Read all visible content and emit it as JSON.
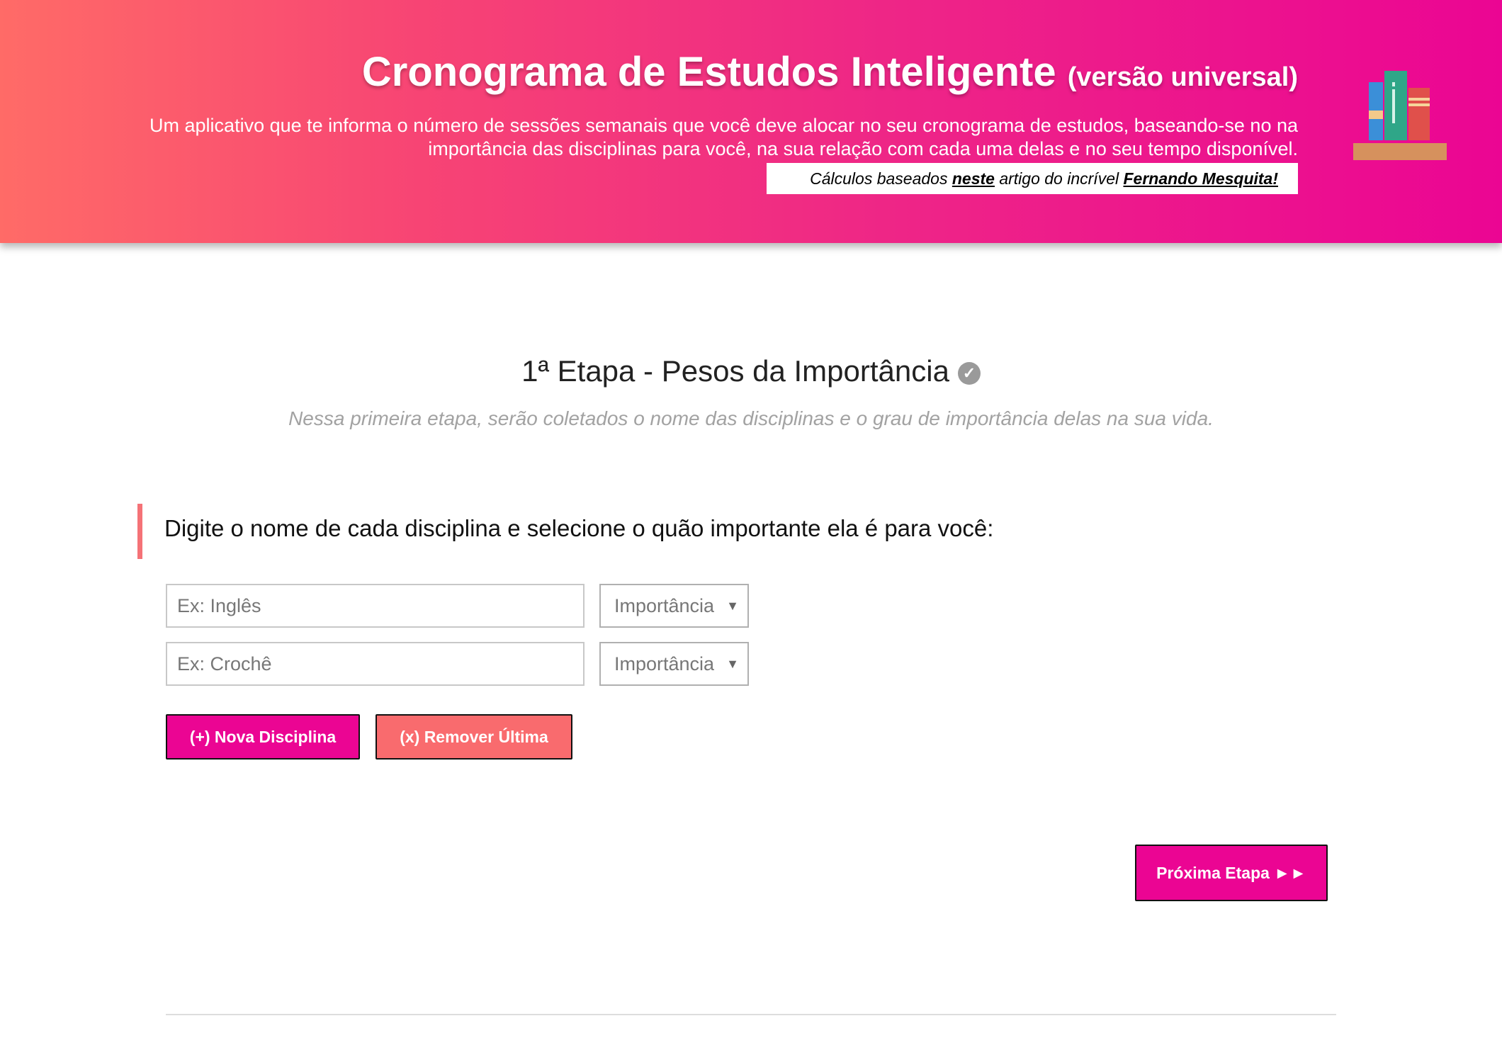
{
  "header": {
    "title": "Cronograma de Estudos Inteligente",
    "title_suffix": "(versão universal)",
    "description": "Um aplicativo que te informa o número de sessões semanais que você deve alocar no seu cronograma de estudos, baseando-se no na importância das disciplinas para você, na sua relação com cada uma delas e no seu tempo disponível.",
    "credit_prefix": "Cálculos baseados",
    "credit_link1": "neste",
    "credit_middle": "artigo do incrível",
    "credit_link2": "Fernando Mesquita!",
    "icon": "books-on-shelf-icon"
  },
  "step": {
    "title": "1ª Etapa - Pesos da Importância",
    "subtitle": "Nessa primeira etapa, serão coletados o nome das disciplinas e o grau de importância delas na sua vida.",
    "check_icon": "check-circle-icon"
  },
  "instruction": "Digite o nome de cada disciplina e selecione o quão importante ela é para você:",
  "disciplines": [
    {
      "placeholder": "Ex: Inglês",
      "select_label": "Importância"
    },
    {
      "placeholder": "Ex: Crochê",
      "select_label": "Importância"
    }
  ],
  "buttons": {
    "add": "(+) Nova Disciplina",
    "remove": "(x) Remover Última",
    "next": "Próxima Etapa ►►"
  },
  "colors": {
    "accent_pink": "#eb0593",
    "accent_coral": "#f96b6e",
    "quote_bar": "#f57277"
  }
}
